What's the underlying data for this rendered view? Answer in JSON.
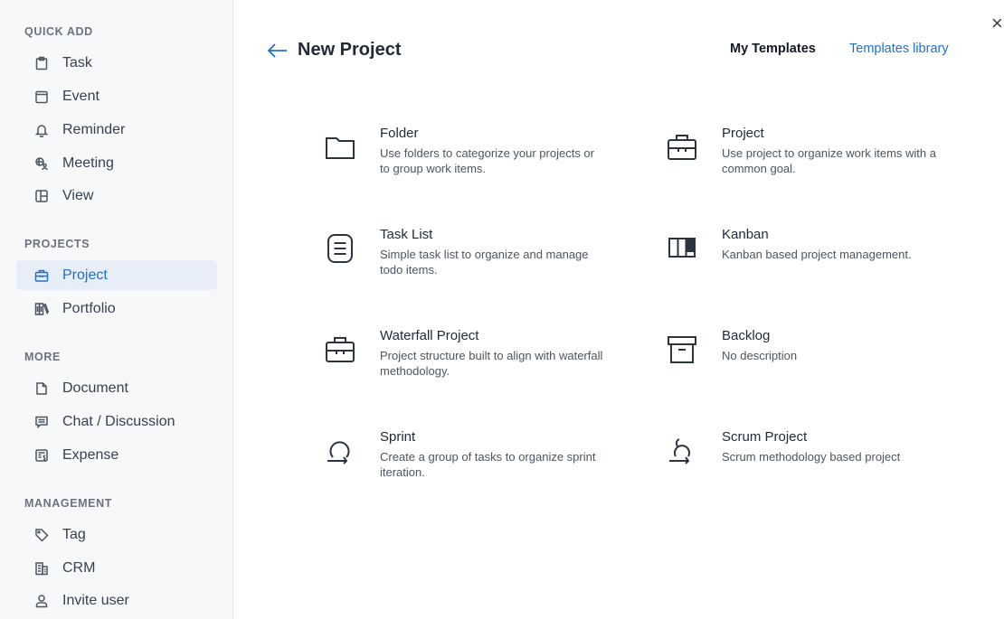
{
  "sidebar": {
    "sections": {
      "quick_add": "QUICK ADD",
      "projects": "PROJECTS",
      "more": "MORE",
      "management": "MANAGEMENT"
    },
    "items": {
      "task": {
        "label": "Task",
        "icon": "clipboard-icon"
      },
      "event": {
        "label": "Event",
        "icon": "calendar-icon"
      },
      "reminder": {
        "label": "Reminder",
        "icon": "bell-icon"
      },
      "meeting": {
        "label": "Meeting",
        "icon": "meeting-icon"
      },
      "view": {
        "label": "View",
        "icon": "layout-icon"
      },
      "project": {
        "label": "Project",
        "icon": "briefcase-icon",
        "active": true
      },
      "portfolio": {
        "label": "Portfolio",
        "icon": "books-icon"
      },
      "document": {
        "label": "Document",
        "icon": "document-icon"
      },
      "chat": {
        "label": "Chat / Discussion",
        "icon": "chat-icon"
      },
      "expense": {
        "label": "Expense",
        "icon": "receipt-icon"
      },
      "tag": {
        "label": "Tag",
        "icon": "tag-icon"
      },
      "crm": {
        "label": "CRM",
        "icon": "building-icon"
      },
      "invite": {
        "label": "Invite user",
        "icon": "user-icon"
      }
    }
  },
  "header": {
    "title": "New Project",
    "tabs": {
      "my_templates": "My Templates",
      "templates_library": "Templates library"
    },
    "close": "×"
  },
  "templates": {
    "folder": {
      "title": "Folder",
      "desc": "Use folders to categorize your projects or to group work items."
    },
    "project": {
      "title": "Project",
      "desc": "Use project to organize work items with a common goal."
    },
    "task_list": {
      "title": "Task List",
      "desc": "Simple task list to organize and manage todo items."
    },
    "kanban": {
      "title": "Kanban",
      "desc": "Kanban based project management."
    },
    "waterfall": {
      "title": "Waterfall Project",
      "desc": "Project structure built to align with waterfall methodology."
    },
    "backlog": {
      "title": "Backlog",
      "desc": "No description"
    },
    "sprint": {
      "title": "Sprint",
      "desc": "Create a group of tasks to organize sprint iteration."
    },
    "scrum": {
      "title": "Scrum Project",
      "desc": "Scrum methodology based project"
    }
  },
  "colors": {
    "accent": "#1f6fd1",
    "active_bg": "#e8eef8",
    "sidebar_bg": "#f7f8f9"
  }
}
